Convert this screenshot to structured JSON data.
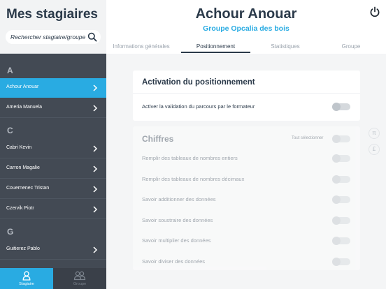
{
  "sidebar": {
    "title": "Mes stagiaires",
    "search_placeholder": "Rechercher stagiaire/groupe",
    "icons": {
      "search": "search-icon",
      "chevron": "chevron-right-icon"
    },
    "sections": [
      {
        "letter": "A",
        "items": [
          {
            "name": "Achour Anouar",
            "active": true
          },
          {
            "name": "Ameria Manuela",
            "active": false
          }
        ]
      },
      {
        "letter": "C",
        "items": [
          {
            "name": "Cabri Kevin"
          },
          {
            "name": "Carron Magalie"
          },
          {
            "name": "Couernenec Tristan"
          },
          {
            "name": "Czervik Piotr"
          }
        ]
      },
      {
        "letter": "G",
        "items": [
          {
            "name": "Guitierez Pablo"
          }
        ]
      }
    ],
    "bottom_tabs": [
      {
        "label": "Stagiaire",
        "icon": "person-icon",
        "active": true
      },
      {
        "label": "Groupe",
        "icon": "group-icon",
        "active": false
      }
    ]
  },
  "header": {
    "person_name": "Achour Anouar",
    "group_name": "Groupe Opcalia des bois",
    "power_icon": "power-icon",
    "tabs": [
      {
        "label": "Informations générales",
        "active": false
      },
      {
        "label": "Positionnement",
        "active": true
      },
      {
        "label": "Statistiques",
        "active": false
      },
      {
        "label": "Groupe",
        "active": false
      }
    ]
  },
  "activation": {
    "title": "Activation du positionnement",
    "label": "Activer la validation du parcours par le formateur",
    "enabled": false
  },
  "chiffres": {
    "title": "Chiffres",
    "select_all_label": "Tout sélectionner",
    "items": [
      {
        "label": "Remplir des tableaux de nombres entiers",
        "enabled": false
      },
      {
        "label": "Remplir des tableaux de nombres décimaux",
        "enabled": false
      },
      {
        "label": "Savoir additionner des données",
        "enabled": false
      },
      {
        "label": "Savoir soustraire des données",
        "enabled": false
      },
      {
        "label": "Savoir multiplier des données",
        "enabled": false
      },
      {
        "label": "Savoir diviser des données",
        "enabled": false
      }
    ]
  },
  "side_controls": [
    {
      "glyph": "π",
      "icon": "pi-icon"
    },
    {
      "glyph": "£",
      "icon": "pound-icon"
    }
  ],
  "colors": {
    "accent": "#29abe2",
    "sidebar": "#434a54",
    "text_dark": "#2b3a4a"
  }
}
